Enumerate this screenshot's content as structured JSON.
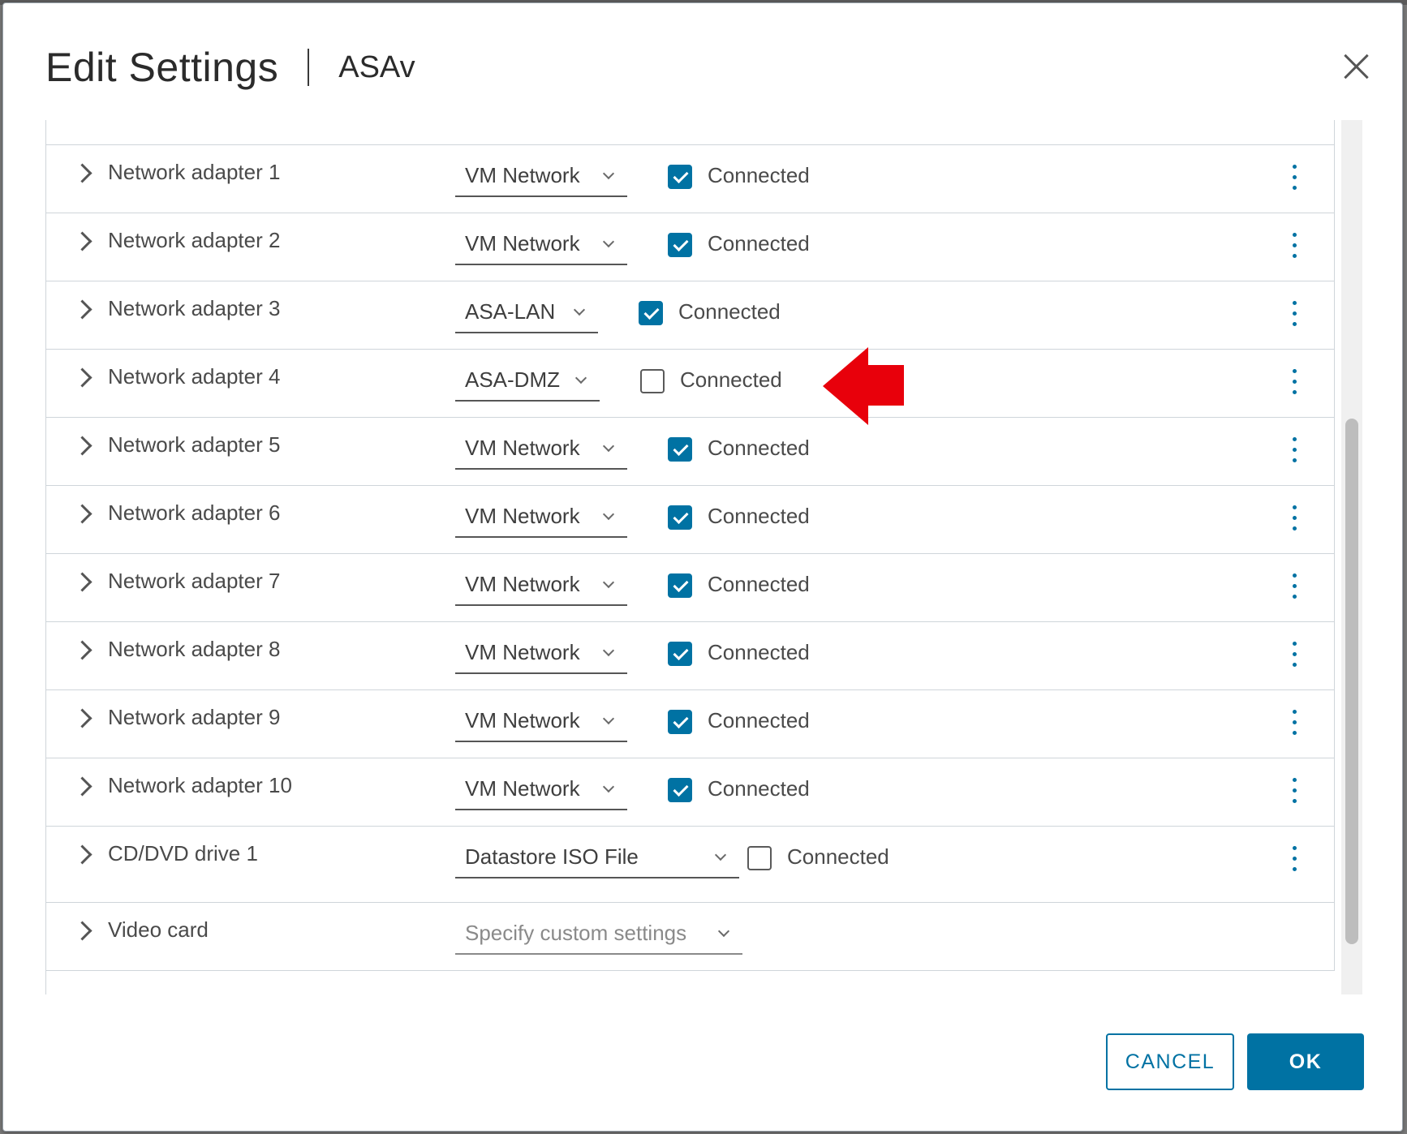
{
  "dialog": {
    "title": "Edit Settings",
    "subtitle": "ASAv",
    "close_icon": "close-icon"
  },
  "rows": [
    {
      "label": "Network adapter 1",
      "network": "VM Network",
      "connected": true,
      "connected_label": "Connected"
    },
    {
      "label": "Network adapter 2",
      "network": "VM Network",
      "connected": true,
      "connected_label": "Connected"
    },
    {
      "label": "Network adapter 3",
      "network": "ASA-LAN",
      "connected": true,
      "connected_label": "Connected"
    },
    {
      "label": "Network adapter 4",
      "network": "ASA-DMZ",
      "connected": false,
      "connected_label": "Connected"
    },
    {
      "label": "Network adapter 5",
      "network": "VM Network",
      "connected": true,
      "connected_label": "Connected"
    },
    {
      "label": "Network adapter 6",
      "network": "VM Network",
      "connected": true,
      "connected_label": "Connected"
    },
    {
      "label": "Network adapter 7",
      "network": "VM Network",
      "connected": true,
      "connected_label": "Connected"
    },
    {
      "label": "Network adapter 8",
      "network": "VM Network",
      "connected": true,
      "connected_label": "Connected"
    },
    {
      "label": "Network adapter 9",
      "network": "VM Network",
      "connected": true,
      "connected_label": "Connected"
    },
    {
      "label": "Network adapter 10",
      "network": "VM Network",
      "connected": true,
      "connected_label": "Connected"
    },
    {
      "label": "CD/DVD drive 1",
      "network": "Datastore ISO File",
      "connected": false,
      "connected_label": "Connected"
    },
    {
      "label": "Video card",
      "network": "Specify custom settings"
    }
  ],
  "footer": {
    "cancel_label": "CANCEL",
    "ok_label": "OK"
  },
  "colors": {
    "accent": "#0072a3",
    "annotation_arrow": "#e8000b"
  }
}
